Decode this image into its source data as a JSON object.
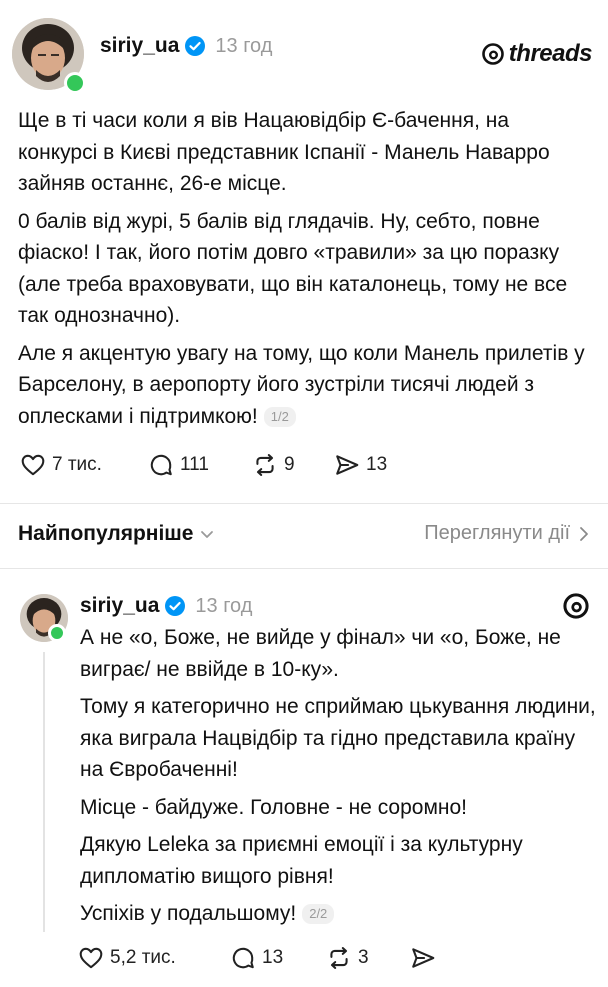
{
  "post1": {
    "username": "siriy_ua",
    "time": "13 год",
    "paragraphs": [
      "Ще в ті часи коли я вів Нацаювідбір Є-бачення, на конкурсі в Києві представник Іспанії - Манель Наварро зайняв останнє, 26-е місце.",
      "0 балів від журі, 5 балів від глядачів. Ну, себто, повне фіаско! І так, його потім довго «травили» за цю поразку (але треба враховувати, що він каталонець, тому не все так однозначно).",
      "Але я акцентую увагу на тому, що коли Манель прилетів у Барселону, в аеропорту його зустріли тисячі людей з оплесками і підтримкою!"
    ],
    "page_badge": "1/2",
    "likes": "7 тис.",
    "replies": "111",
    "reposts": "9",
    "shares": "13"
  },
  "brand": {
    "name": "threads"
  },
  "sort": {
    "label": "Найпопулярніше",
    "view_actions": "Переглянути дії"
  },
  "post2": {
    "username": "siriy_ua",
    "time": "13 год",
    "paragraphs": [
      "А не «о, Боже, не вийде у фінал» чи «о, Боже, не виграє/ не ввійде в 10-ку».",
      "Тому я категорично не сприймаю цькування людини, яка виграла Нацвідбір та гідно представила країну на Євробаченні!",
      "Місце - байдуже. Головне - не соромно!",
      "Дякую Leleka за приємні емоції і за культурну дипломатію вищого рівня!",
      "Успіхів у подальшому!"
    ],
    "page_badge": "2/2",
    "likes": "5,2 тис.",
    "replies": "13",
    "reposts": "3"
  },
  "colors": {
    "verified": "#0095f6",
    "online": "#34c759",
    "muted": "#9a9a9a"
  },
  "icons": [
    "verified-badge-icon",
    "threads-logo-icon",
    "heart-icon",
    "comment-icon",
    "repost-icon",
    "share-icon",
    "chevron-down-icon",
    "chevron-right-icon"
  ]
}
